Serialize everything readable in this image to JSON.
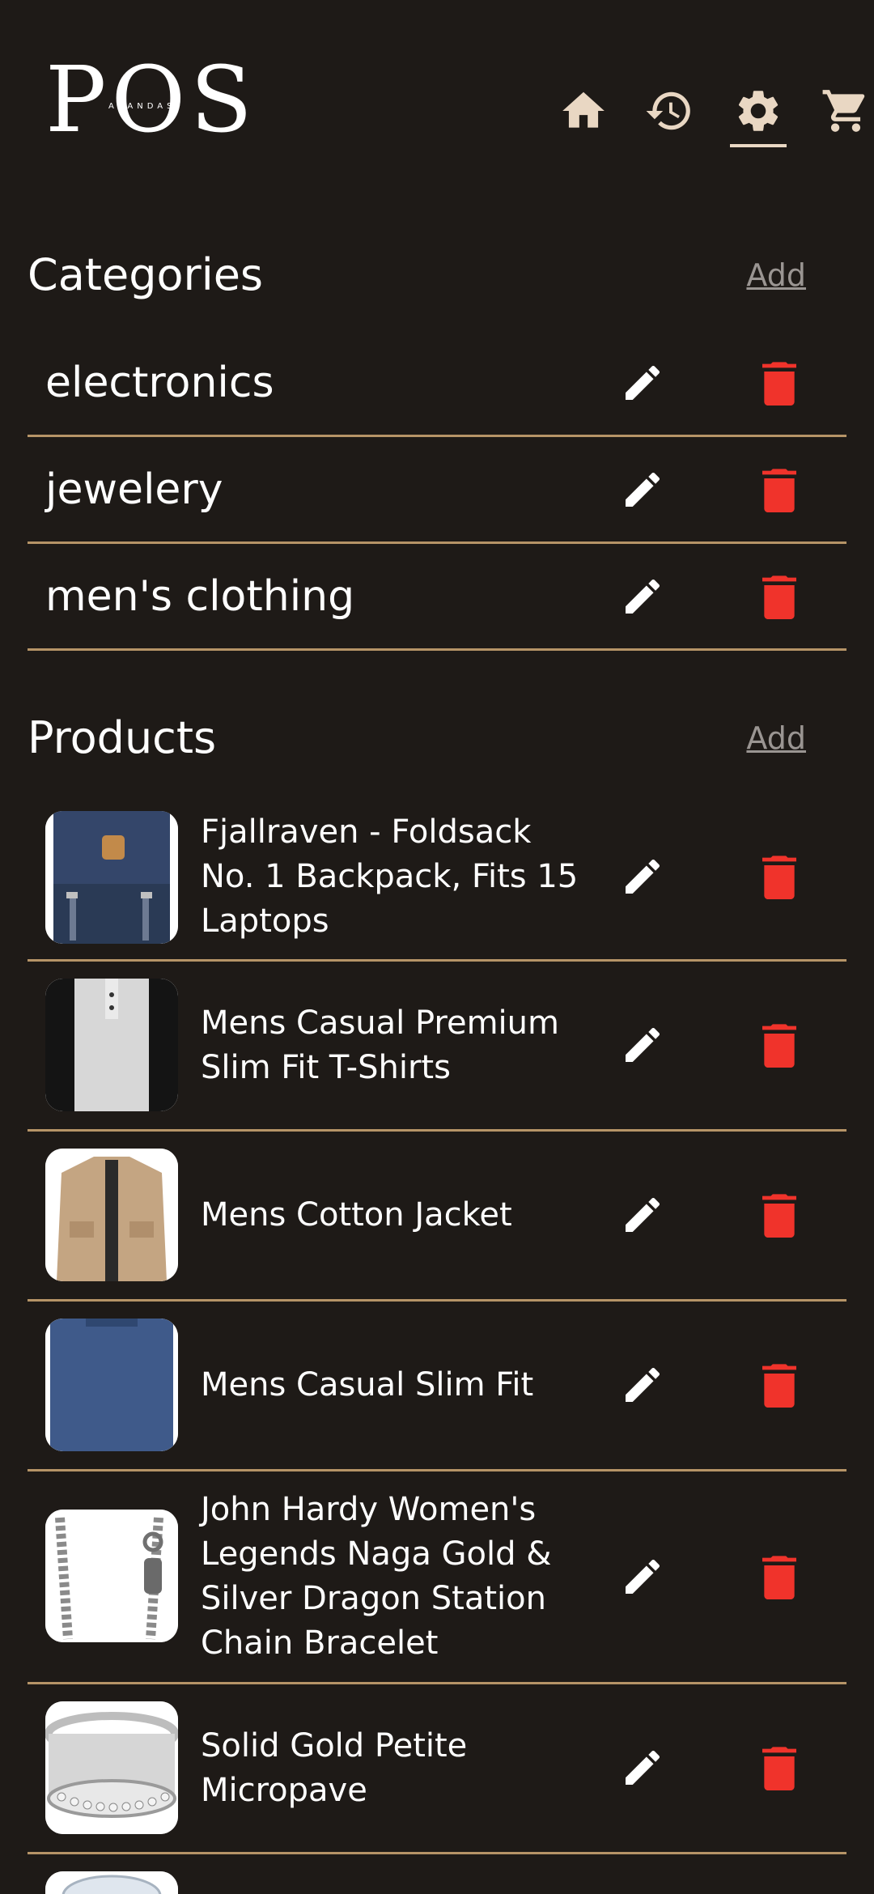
{
  "brand": {
    "logo_text": "POS",
    "logo_subtext": "ARANDAS"
  },
  "nav": {
    "items": [
      {
        "icon": "home-icon",
        "active": false
      },
      {
        "icon": "history-icon",
        "active": false
      },
      {
        "icon": "settings-icon",
        "active": true
      },
      {
        "icon": "cart-icon",
        "active": false
      }
    ]
  },
  "categories": {
    "title": "Categories",
    "add_label": "Add",
    "items": [
      {
        "label": "electronics"
      },
      {
        "label": "jewelery"
      },
      {
        "label": "men's clothing"
      }
    ]
  },
  "products": {
    "title": "Products",
    "add_label": "Add",
    "items": [
      {
        "name": "Fjallraven - Foldsack No. 1 Backpack, Fits 15 Laptops",
        "thumb": "backpack-image"
      },
      {
        "name": "Mens Casual Premium Slim Fit T-Shirts",
        "thumb": "tshirt-image"
      },
      {
        "name": "Mens Cotton Jacket",
        "thumb": "jacket-image"
      },
      {
        "name": "Mens Casual Slim Fit",
        "thumb": "longsleeve-image"
      },
      {
        "name": "John Hardy Women's Legends Naga Gold & Silver Dragon Station Chain Bracelet",
        "thumb": "bracelet-image"
      },
      {
        "name": "Solid Gold Petite Micropave",
        "thumb": "ring-image"
      }
    ]
  },
  "colors": {
    "background": "#1e1a17",
    "divider": "#b69467",
    "delete": "#f0332b",
    "nav_icon": "#e9d7c3",
    "link": "#9a9592"
  }
}
